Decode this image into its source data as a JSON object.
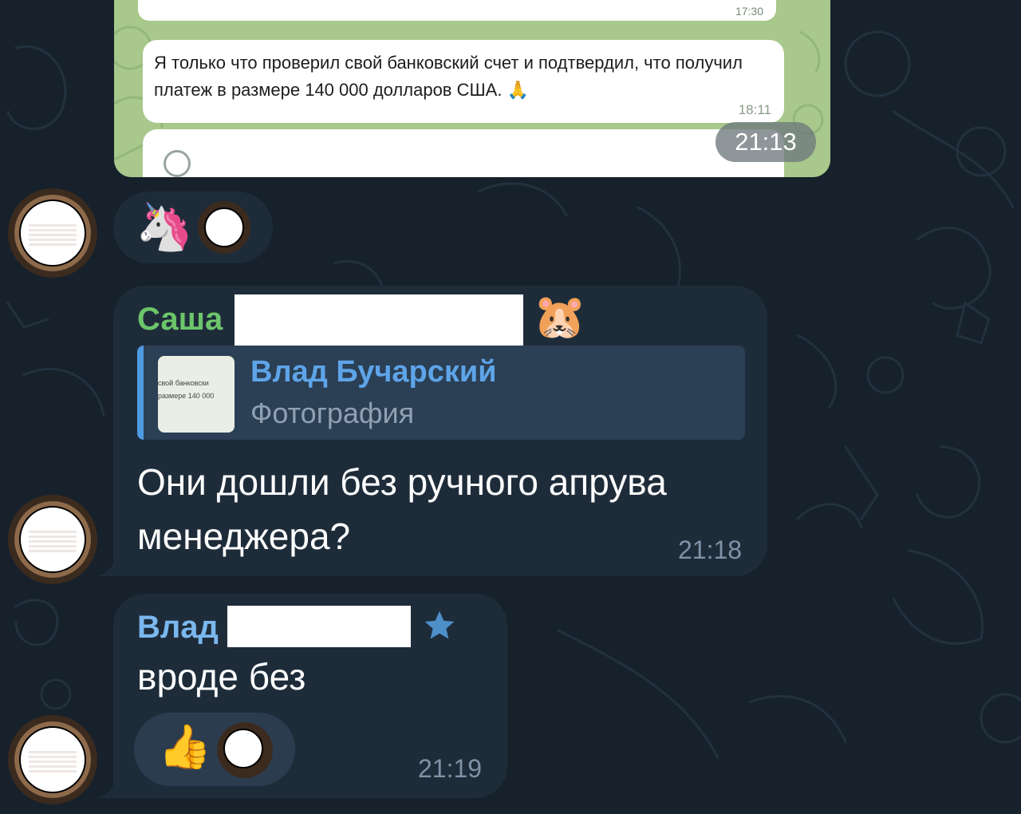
{
  "photo_message": {
    "truncated_time": "17:30",
    "forwarded_text": "Я только что проверил свой банковский счет и подтвердил, что получил платеж в размере 140 000 долларов США. 🙏",
    "forwarded_time": "18:11",
    "time": "21:13"
  },
  "reaction_message": {
    "emoji": "🦄"
  },
  "message_sasha": {
    "sender": "Саша",
    "sender_emoji": "🐹",
    "reply": {
      "name": "Влад Бучарский",
      "type": "Фотография",
      "thumb_lines": [
        "свой банковски",
        "размере 140 000"
      ]
    },
    "text_line1": "Они дошли без ручного апрува",
    "text_line2": "менеджера?",
    "time": "21:18"
  },
  "message_vlad": {
    "sender": "Влад",
    "text": "вроде без",
    "reaction_emoji": "👍",
    "time": "21:19"
  },
  "colors": {
    "background": "#17212b",
    "bubble": "#1e2c3a",
    "sasha_name": "#6cc56a",
    "vlad_name": "#7ab8ee"
  }
}
